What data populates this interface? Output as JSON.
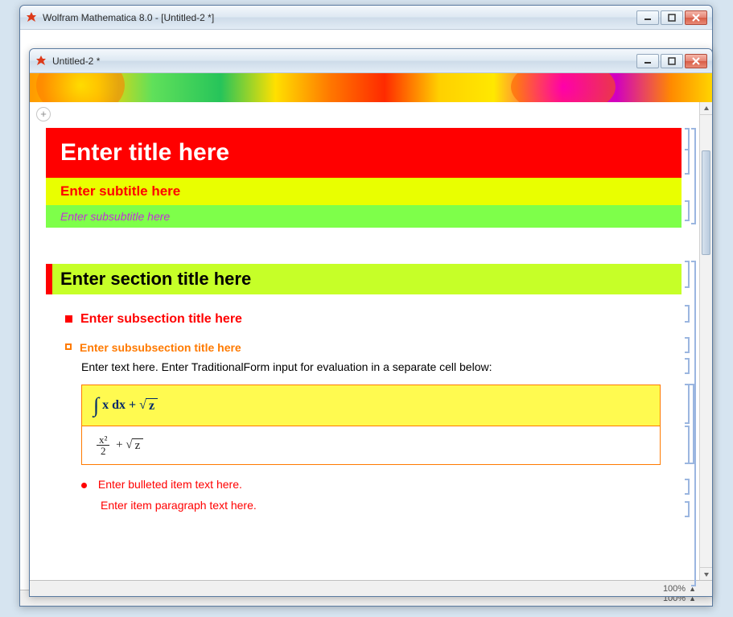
{
  "backWindow": {
    "title": "Wolfram Mathematica 8.0 - [Untitled-2 *]",
    "zoom": "100%"
  },
  "frontWindow": {
    "title": "Untitled-2 *",
    "zoom": "100%"
  },
  "cells": {
    "title": "Enter title here",
    "subtitle": "Enter subtitle here",
    "subsubtitle": "Enter subsubtitle here",
    "section": "Enter section title here",
    "subsection": "Enter subsection title here",
    "subsubsection": "Enter subsubsection title here",
    "text": "Enter text here. Enter TraditionalForm input for evaluation in a separate cell below:",
    "math_input": "∫ x dx + √z",
    "math_output": "x²/2 + √z",
    "bulleted": "Enter bulleted item text here.",
    "item_paragraph": "Enter item paragraph text here."
  },
  "icons": {
    "plus": "+"
  }
}
